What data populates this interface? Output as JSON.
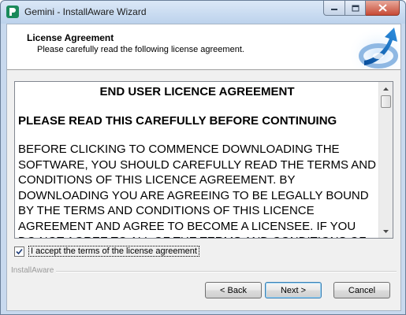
{
  "window": {
    "title": "Gemini - InstallAware Wizard"
  },
  "header": {
    "title": "License Agreement",
    "subtitle": "Please carefully read the following license agreement."
  },
  "license": {
    "heading": "END USER LICENCE AGREEMENT",
    "subheading": "PLEASE READ THIS CAREFULLY BEFORE CONTINUING",
    "body": "BEFORE CLICKING TO COMMENCE DOWNLOADING THE SOFTWARE, YOU SHOULD CAREFULLY READ THE TERMS AND CONDITIONS OF THIS LICENCE AGREEMENT.  BY DOWNLOADING YOU ARE AGREEING TO BE LEGALLY BOUND BY THE TERMS AND CONDITIONS OF THIS LICENCE AGREEMENT AND AGREE TO BECOME A LICENSEE.  IF YOU DO NOT AGREE TO ALL OF THE TERMS AND CONDITIONS OF THIS LICENCE"
  },
  "accept": {
    "label": "I accept the terms of the license agreement",
    "checked": true
  },
  "brand": "InstallAware",
  "buttons": {
    "back": "< Back",
    "next": "Next >",
    "cancel": "Cancel"
  },
  "icons": {
    "app": "installaware-app-icon",
    "header": "installaware-header-graphic",
    "minimize": "minimize-icon",
    "maximize": "maximize-icon",
    "close": "close-icon",
    "scroll_up": "scroll-up-arrow-icon",
    "scroll_down": "scroll-down-arrow-icon",
    "checkmark": "checkmark-icon"
  },
  "colors": {
    "title_bar": "#c8d9ee",
    "close_button": "#c74a35",
    "default_button_border": "#3c7fb1"
  }
}
